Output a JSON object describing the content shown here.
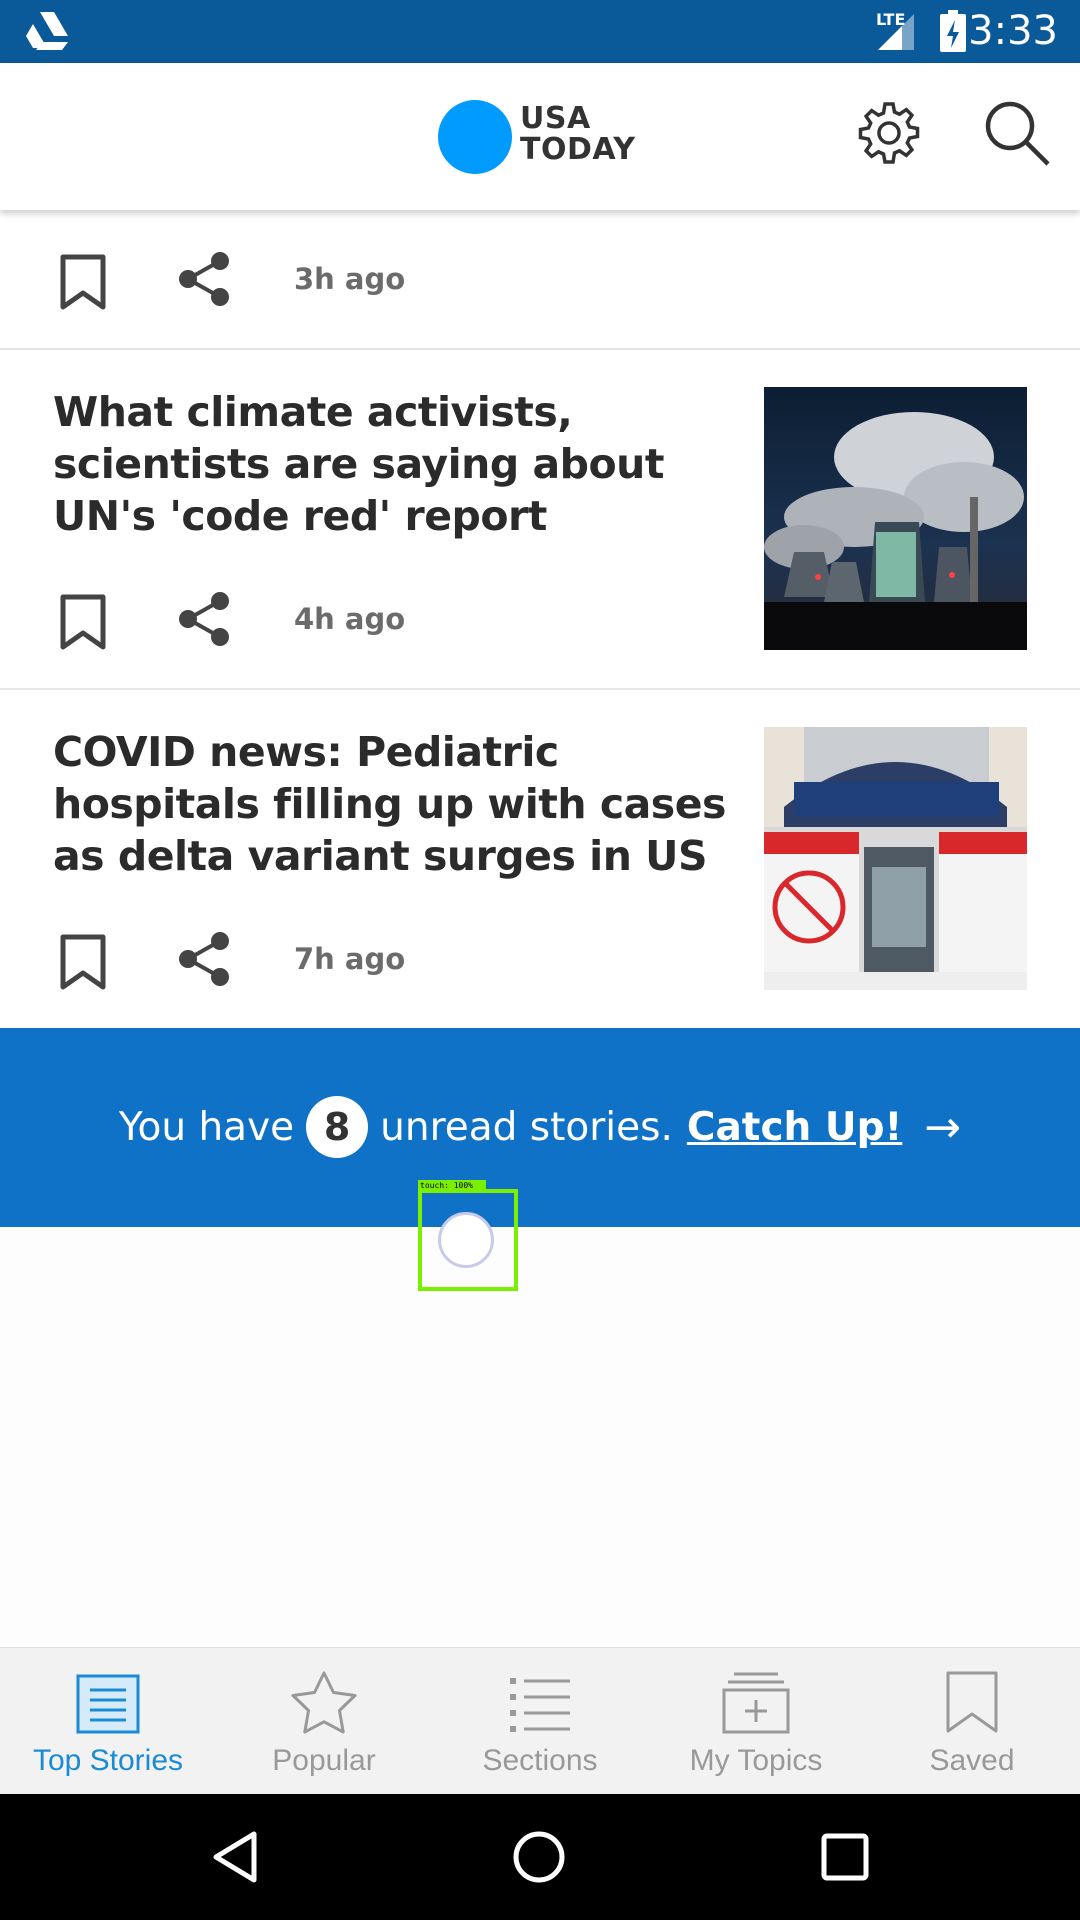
{
  "status_bar": {
    "time": "3:33",
    "network": "LTE"
  },
  "header": {
    "logo_line1": "USA",
    "logo_line2": "TODAY"
  },
  "articles": [
    {
      "time_ago": "3h ago"
    },
    {
      "title": "What climate activists, scientists are saying about UN's 'code red' report",
      "time_ago": "4h ago"
    },
    {
      "title": "COVID news: Pediatric hospitals filling up with cases as delta variant surges in US",
      "time_ago": "7h ago"
    }
  ],
  "banner": {
    "prefix": "You have",
    "count": "8",
    "suffix": "unread stories.",
    "link": "Catch Up!",
    "arrow": "→"
  },
  "touch_overlay": {
    "label": "touch: 100%"
  },
  "bottom_nav": [
    {
      "label": "Top Stories",
      "icon": "top-stories-icon",
      "active": true
    },
    {
      "label": "Popular",
      "icon": "star-icon",
      "active": false
    },
    {
      "label": "Sections",
      "icon": "list-icon",
      "active": false
    },
    {
      "label": "My Topics",
      "icon": "my-topics-icon",
      "active": false
    },
    {
      "label": "Saved",
      "icon": "bookmark-icon",
      "active": false
    }
  ],
  "colors": {
    "status_bar": "#0a5a99",
    "logo": "#009bff",
    "banner": "#0f72c6",
    "active_nav": "#1b8bd6",
    "inactive_nav": "#999999"
  }
}
